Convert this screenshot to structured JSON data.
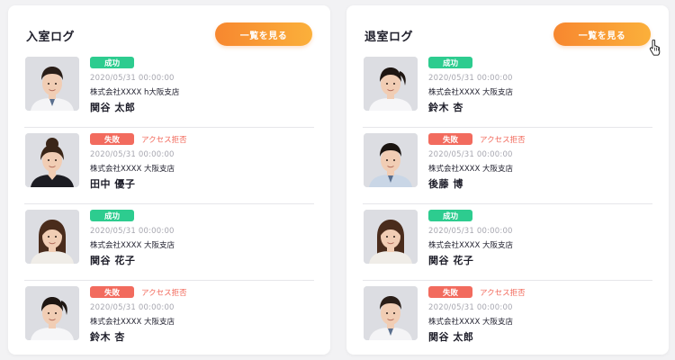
{
  "panels": [
    {
      "title": "入室ログ",
      "button_label": "一覧を見る",
      "entries": [
        {
          "status": "成功",
          "status_type": "success",
          "reason": "",
          "timestamp": "2020/05/31 00:00:00",
          "location": "株式会社XXXX h大阪支店",
          "name": "関谷 太郎",
          "avatar": "male-short-hair",
          "hair": "#2a1e18",
          "shirt": "#f4f4f6"
        },
        {
          "status": "失敗",
          "status_type": "failure",
          "reason": "アクセス拒否",
          "timestamp": "2020/05/31 00:00:00",
          "location": "株式会社XXXX 大阪支店",
          "name": "田中 優子",
          "avatar": "female-hair-up",
          "hair": "#3a2618",
          "shirt": "#1c1c22"
        },
        {
          "status": "成功",
          "status_type": "success",
          "reason": "",
          "timestamp": "2020/05/31 00:00:00",
          "location": "株式会社XXXX 大阪支店",
          "name": "関谷 花子",
          "avatar": "female-long-hair",
          "hair": "#4a2c1c",
          "shirt": "#f0ede8"
        },
        {
          "status": "失敗",
          "status_type": "failure",
          "reason": "アクセス拒否",
          "timestamp": "2020/05/31 00:00:00",
          "location": "株式会社XXXX 大阪支店",
          "name": "鈴木 杏",
          "avatar": "female-ponytail",
          "hair": "#1e1612",
          "shirt": "#f6f6f8"
        }
      ]
    },
    {
      "title": "退室ログ",
      "button_label": "一覧を見る",
      "entries": [
        {
          "status": "成功",
          "status_type": "success",
          "reason": "",
          "timestamp": "2020/05/31 00:00:00",
          "location": "株式会社XXXX 大阪支店",
          "name": "鈴木 杏",
          "avatar": "female-ponytail",
          "hair": "#1e1612",
          "shirt": "#f6f6f8"
        },
        {
          "status": "失敗",
          "status_type": "failure",
          "reason": "アクセス拒否",
          "timestamp": "2020/05/31 00:00:00",
          "location": "株式会社XXXX 大阪支店",
          "name": "後藤 博",
          "avatar": "male-short-hair",
          "hair": "#1a1410",
          "shirt": "#c9d6e6"
        },
        {
          "status": "成功",
          "status_type": "success",
          "reason": "",
          "timestamp": "2020/05/31 00:00:00",
          "location": "株式会社XXXX 大阪支店",
          "name": "関谷 花子",
          "avatar": "female-long-hair",
          "hair": "#4a2c1c",
          "shirt": "#f0ede8"
        },
        {
          "status": "失敗",
          "status_type": "failure",
          "reason": "アクセス拒否",
          "timestamp": "2020/05/31 00:00:00",
          "location": "株式会社XXXX 大阪支店",
          "name": "関谷 太郎",
          "avatar": "male-short-hair",
          "hair": "#2a1e18",
          "shirt": "#f4f4f6"
        }
      ]
    }
  ],
  "colors": {
    "success": "#2dcc8f",
    "failure": "#f26b5e",
    "button_gradient_start": "#f7872f",
    "button_gradient_end": "#fbb03b",
    "skin": "#f1cdb4",
    "photo_bg": "#dcdde2"
  },
  "cursor_icon": "hand-pointer-icon"
}
